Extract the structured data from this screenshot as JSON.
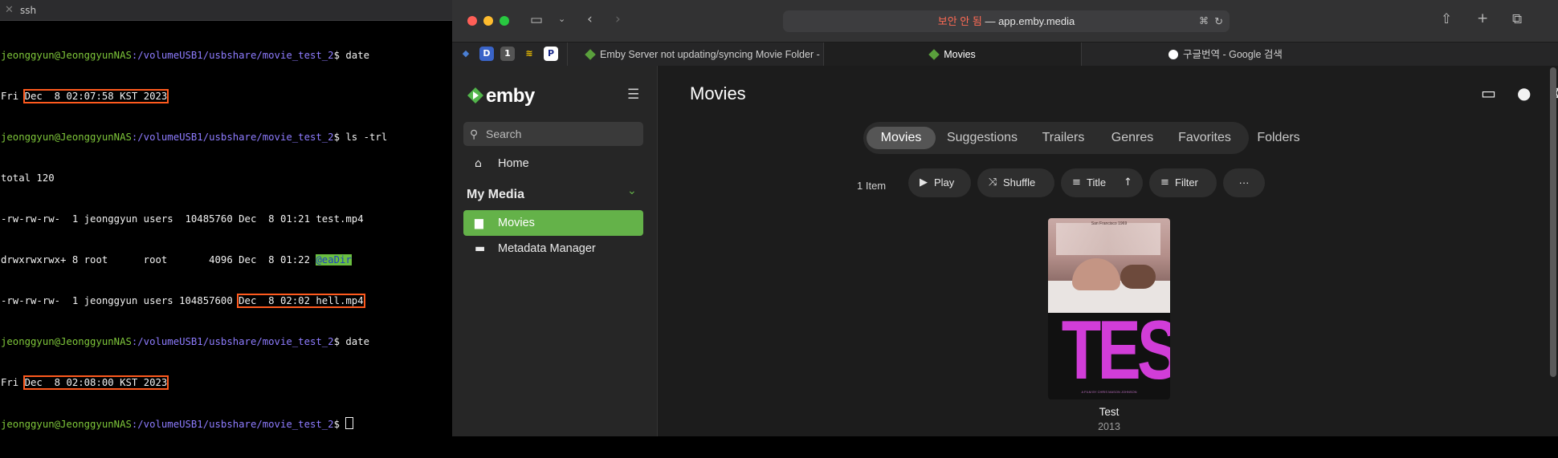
{
  "terminal": {
    "title": "ssh",
    "close_glyph": "✕",
    "prompt_user": "jeonggyun@JeonggyunNAS",
    "prompt_path": ":/volumeUSB1/usbshare/movie_test_2",
    "prompt_suffix": "$ ",
    "cmd1": "date",
    "out1_prefix": "Fri ",
    "out1_date": "Dec  8 02:07:58 KST 2023",
    "cmd2": "ls -trl",
    "total": "total 120",
    "ls_line1": "-rw-rw-rw-  1 jeonggyun users  10485760 Dec  8 01:21 test.mp4",
    "ls_line2_prefix": "drwxrwxrwx+ 8 root      root       4096 Dec  8 01:22 ",
    "ls_line2_dir": "@eaDir",
    "ls_line3_prefix": "-rw-rw-rw-  1 jeonggyun users 104857600 ",
    "ls_line3_hl": "Dec  8 02:02 hell.mp4",
    "cmd3": "date",
    "out3_prefix": "Fri ",
    "out3_date": "Dec  8 02:08:00 KST 2023"
  },
  "browser": {
    "url_warning": "보안 안 됨",
    "url_sep": " — ",
    "url_host": "app.emby.media",
    "pinned": [
      "D",
      "1",
      "P"
    ],
    "tabs": [
      {
        "label": "Emby Server not updating/syncing Movie Folder - Synology - E..."
      },
      {
        "label": "Movies"
      },
      {
        "label": "구글번역 - Google 검색"
      }
    ]
  },
  "emby": {
    "logo": "emby",
    "search_placeholder": "Search",
    "home": "Home",
    "section": "My Media",
    "nav_movies": "Movies",
    "nav_metadata": "Metadata Manager",
    "page_title": "Movies",
    "tabs": [
      "Movies",
      "Suggestions",
      "Trailers",
      "Genres",
      "Favorites",
      "Folders"
    ],
    "item_count": "1 Item",
    "btn_play": "Play",
    "btn_shuffle": "Shuffle",
    "btn_sort": "Title",
    "btn_filter": "Filter",
    "btn_more": "···",
    "movie_title": "Test",
    "movie_year": "2013",
    "poster_text": "TEST",
    "poster_small": "San Francisco 1969",
    "poster_credit": "A FILM BY CHRIS MASON JOHNSON",
    "accent": "#64b249"
  }
}
